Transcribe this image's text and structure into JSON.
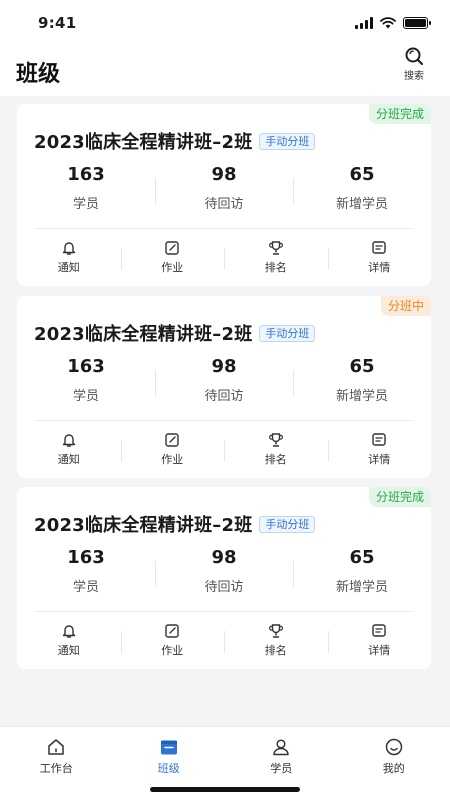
{
  "status_bar": {
    "time": "9:41"
  },
  "header": {
    "title": "班级",
    "search_label": "搜索"
  },
  "cards": [
    {
      "tag": "分班完成",
      "title": "2023临床全程精讲班–2班",
      "mode": "手动分班",
      "stats": [
        {
          "value": "163",
          "label": "学员"
        },
        {
          "value": "98",
          "label": "待回访"
        },
        {
          "value": "65",
          "label": "新增学员"
        }
      ]
    },
    {
      "tag": "分班中",
      "title": "2023临床全程精讲班–2班",
      "mode": "手动分班",
      "stats": [
        {
          "value": "163",
          "label": "学员"
        },
        {
          "value": "98",
          "label": "待回访"
        },
        {
          "value": "65",
          "label": "新增学员"
        }
      ]
    },
    {
      "tag": "分班完成",
      "title": "2023临床全程精讲班–2班",
      "mode": "手动分班",
      "stats": [
        {
          "value": "163",
          "label": "学员"
        },
        {
          "value": "98",
          "label": "待回访"
        },
        {
          "value": "65",
          "label": "新增学员"
        }
      ]
    }
  ],
  "actions": {
    "notify": "通知",
    "homework": "作业",
    "ranking": "排名",
    "details": "详情"
  },
  "tabbar": {
    "workbench": "工作台",
    "class": "班级",
    "students": "学员",
    "mine": "我的"
  },
  "colors": {
    "accent": "#2c74d6",
    "done": "#27a84a",
    "pending": "#e8882b"
  }
}
